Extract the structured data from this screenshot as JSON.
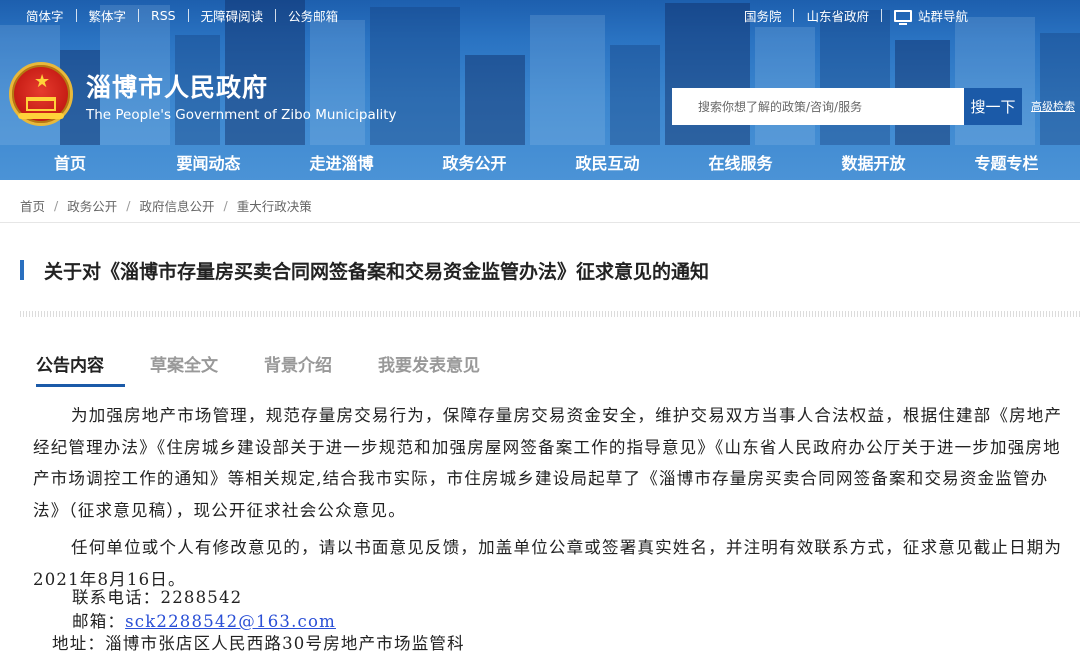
{
  "topbar": {
    "left_links": [
      "简体字",
      "繁体字",
      "RSS",
      "无障碍阅读",
      "公务邮箱"
    ],
    "right_links": [
      "国务院",
      "山东省政府"
    ],
    "site_nav_label": "站群导航"
  },
  "header": {
    "title": "淄博市人民政府",
    "subtitle": "The People's Government of Zibo Municipality",
    "search_placeholder": "搜索你想了解的政策/咨询/服务",
    "search_button": "搜一下",
    "advanced_search": "高级检索"
  },
  "nav": {
    "items": [
      "首页",
      "要闻动态",
      "走进淄博",
      "政务公开",
      "政民互动",
      "在线服务",
      "数据开放",
      "专题专栏"
    ]
  },
  "breadcrumb": [
    "首页",
    "政务公开",
    "政府信息公开",
    "重大行政决策"
  ],
  "article": {
    "title": "关于对《淄博市存量房买卖合同网签备案和交易资金监管办法》征求意见的通知"
  },
  "tabs": {
    "items": [
      "公告内容",
      "草案全文",
      "背景介绍",
      "我要发表意见"
    ],
    "active": "公告内容"
  },
  "body": {
    "paragraph1": "为加强房地产市场管理，规范存量房交易行为，保障存量房交易资金安全，维护交易双方当事人合法权益，根据住建部《房地产经纪管理办法》《住房城乡建设部关于进一步规范和加强房屋网签备案工作的指导意见》《山东省人民政府办公厅关于进一步加强房地产市场调控工作的通知》等相关规定,结合我市实际，市住房城乡建设局起草了《淄博市存量房买卖合同网签备案和交易资金监管办法》（征求意见稿），现公开征求社会公众意见。",
    "paragraph2": "任何单位或个人有修改意见的，请以书面意见反馈，加盖单位公章或签署真实姓名，并注明有效联系方式，征求意见截止日期为2021年8月16日。",
    "phone_label": "联系电话：",
    "phone": "2288542",
    "email_label": "邮箱：",
    "email": "sck2288542@163.com",
    "address_label": "地址：",
    "address": "淄博市张店区人民西路30号房地产市场监管科"
  },
  "colors": {
    "banner": "#2a73c2",
    "nav_text": "#ffffff",
    "accent": "#1b5aa8",
    "link": "#2a4fd6"
  }
}
